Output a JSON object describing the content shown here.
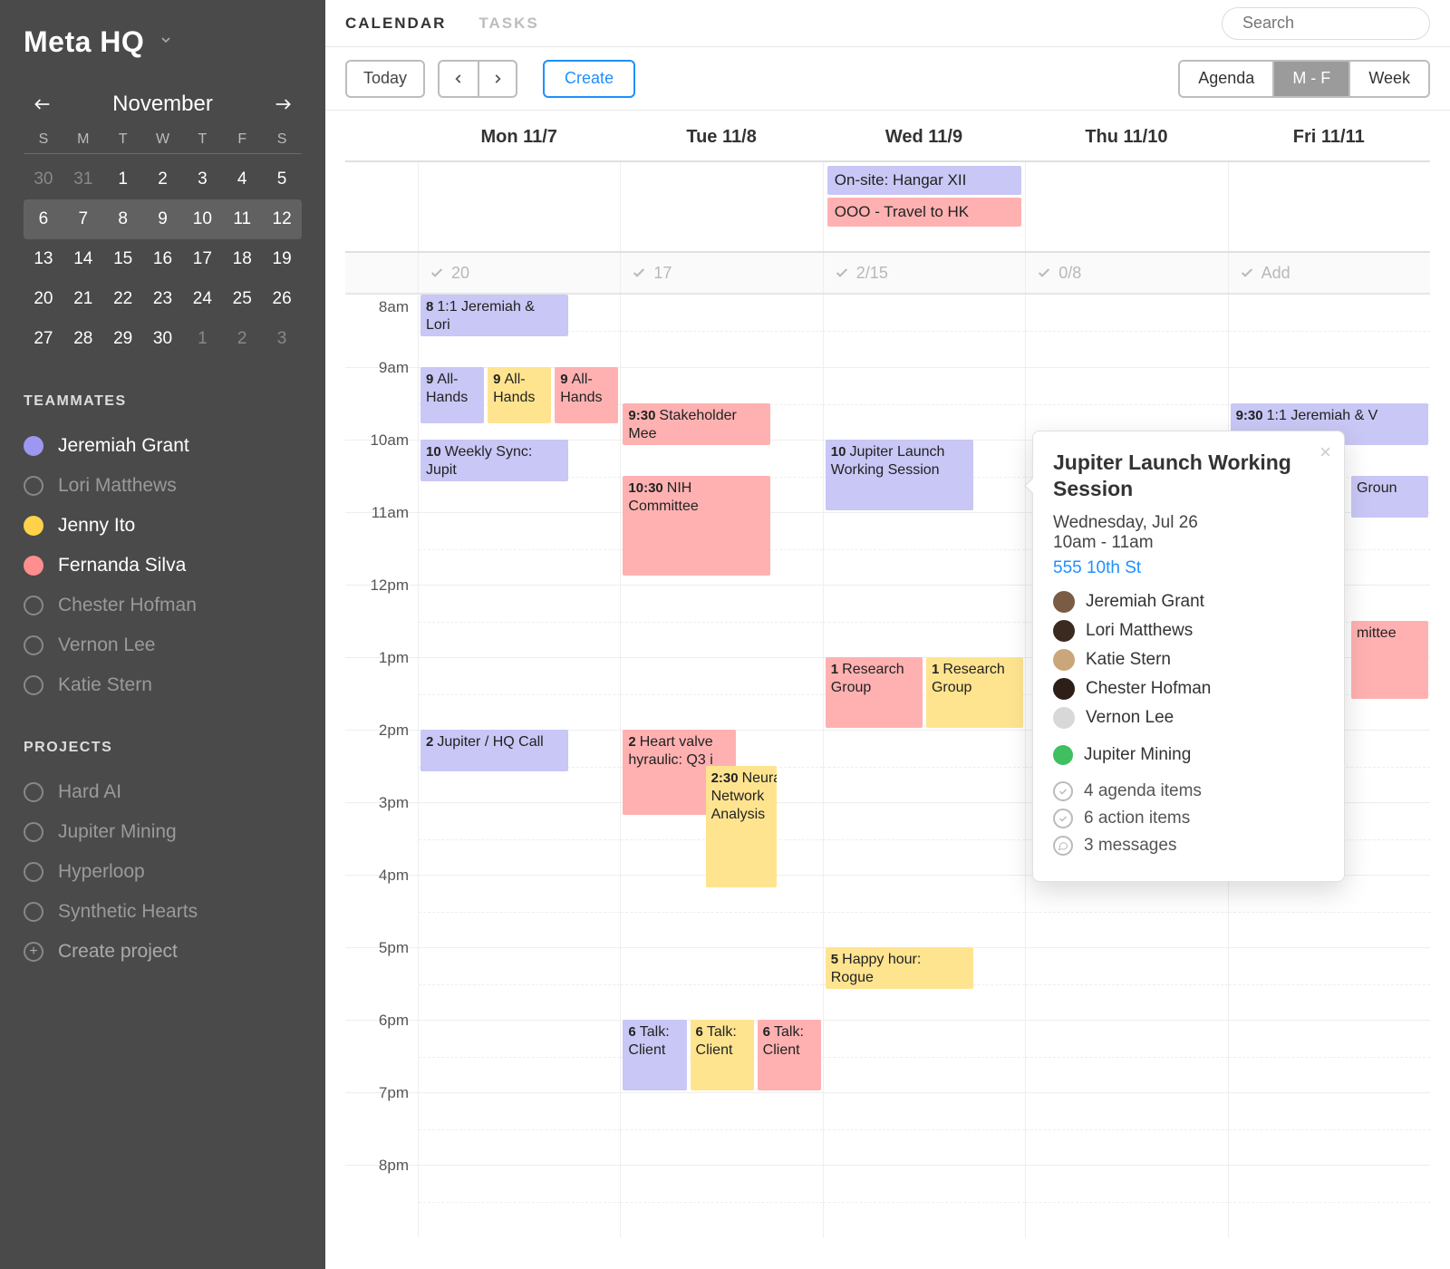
{
  "workspace": {
    "name": "Meta HQ"
  },
  "sidebar": {
    "month_label": "November",
    "dow": [
      "S",
      "M",
      "T",
      "W",
      "T",
      "F",
      "S"
    ],
    "weeks": [
      [
        {
          "n": "30",
          "off": true
        },
        {
          "n": "31",
          "off": true
        },
        {
          "n": "1"
        },
        {
          "n": "2"
        },
        {
          "n": "3"
        },
        {
          "n": "4"
        },
        {
          "n": "5"
        }
      ],
      [
        {
          "n": "6"
        },
        {
          "n": "7"
        },
        {
          "n": "8"
        },
        {
          "n": "9"
        },
        {
          "n": "10"
        },
        {
          "n": "11"
        },
        {
          "n": "12"
        }
      ],
      [
        {
          "n": "13"
        },
        {
          "n": "14"
        },
        {
          "n": "15"
        },
        {
          "n": "16"
        },
        {
          "n": "17"
        },
        {
          "n": "18"
        },
        {
          "n": "19"
        }
      ],
      [
        {
          "n": "20"
        },
        {
          "n": "21"
        },
        {
          "n": "22"
        },
        {
          "n": "23"
        },
        {
          "n": "24"
        },
        {
          "n": "25"
        },
        {
          "n": "26"
        }
      ],
      [
        {
          "n": "27"
        },
        {
          "n": "28"
        },
        {
          "n": "29"
        },
        {
          "n": "30"
        },
        {
          "n": "1",
          "off": true
        },
        {
          "n": "2",
          "off": true
        },
        {
          "n": "3",
          "off": true
        }
      ]
    ],
    "selected_week_index": 1,
    "teammates_label": "TEAMMATES",
    "teammates": [
      {
        "name": "Jeremiah Grant",
        "color": "#9d97f2",
        "active": true
      },
      {
        "name": "Lori Matthews",
        "color": null,
        "active": false
      },
      {
        "name": "Jenny Ito",
        "color": "#ffd24a",
        "active": true
      },
      {
        "name": "Fernanda Silva",
        "color": "#ff8e8e",
        "active": true
      },
      {
        "name": "Chester Hofman",
        "color": null,
        "active": false
      },
      {
        "name": "Vernon Lee",
        "color": null,
        "active": false
      },
      {
        "name": "Katie Stern",
        "color": null,
        "active": false
      }
    ],
    "projects_label": "PROJECTS",
    "projects": [
      {
        "name": "Hard AI"
      },
      {
        "name": "Jupiter Mining"
      },
      {
        "name": "Hyperloop"
      },
      {
        "name": "Synthetic Hearts"
      }
    ],
    "create_project_label": "Create project"
  },
  "topbar": {
    "tab_calendar": "CALENDAR",
    "tab_tasks": "TASKS",
    "search_placeholder": "Search"
  },
  "toolbar": {
    "today_label": "Today",
    "create_label": "Create",
    "views": [
      "Agenda",
      "M - F",
      "Week"
    ],
    "selected_view_index": 1
  },
  "calendar": {
    "days": [
      "Mon 11/7",
      "Tue 11/8",
      "Wed 11/9",
      "Thu 11/10",
      "Fri 11/11"
    ],
    "hours": [
      "8am",
      "9am",
      "10am",
      "11am",
      "12pm",
      "1pm",
      "2pm",
      "3pm",
      "4pm",
      "5pm",
      "6pm",
      "7pm",
      "8pm"
    ],
    "allday": {
      "2": [
        {
          "title": "On-site: Hangar XII",
          "color": "purple"
        },
        {
          "title": "OOO - Travel to HK",
          "color": "red"
        }
      ]
    },
    "taskcounts": [
      "20",
      "17",
      "2/15",
      "0/8",
      "Add"
    ],
    "events": [
      {
        "day": 0,
        "start": 8,
        "end": 8.6,
        "time": "8",
        "title": "1:1 Jeremiah & Lori",
        "color": "purple",
        "lane": 0,
        "lanes": 1,
        "width": 0.75
      },
      {
        "day": 0,
        "start": 9,
        "end": 9.8,
        "time": "9",
        "title": "All-Hands",
        "color": "purple",
        "lane": 0,
        "lanes": 3
      },
      {
        "day": 0,
        "start": 9,
        "end": 9.8,
        "time": "9",
        "title": "All-Hands",
        "color": "yellow",
        "lane": 1,
        "lanes": 3
      },
      {
        "day": 0,
        "start": 9,
        "end": 9.8,
        "time": "9",
        "title": "All-Hands",
        "color": "red",
        "lane": 2,
        "lanes": 3
      },
      {
        "day": 0,
        "start": 10,
        "end": 10.6,
        "time": "10",
        "title": "Weekly Sync: Jupit",
        "color": "purple",
        "lane": 0,
        "lanes": 1,
        "width": 0.75
      },
      {
        "day": 0,
        "start": 14,
        "end": 14.6,
        "time": "2",
        "title": "Jupiter / HQ Call",
        "color": "purple",
        "lane": 0,
        "lanes": 1,
        "width": 0.75
      },
      {
        "day": 1,
        "start": 9.5,
        "end": 10.1,
        "time": "9:30",
        "title": "Stakeholder Mee",
        "color": "red",
        "lane": 0,
        "lanes": 1,
        "width": 0.75
      },
      {
        "day": 1,
        "start": 10.5,
        "end": 11.9,
        "time": "10:30",
        "title": "NIH Committee",
        "color": "red",
        "lane": 0,
        "lanes": 1,
        "width": 0.75
      },
      {
        "day": 1,
        "start": 14,
        "end": 15.2,
        "time": "2",
        "title": "Heart valve hyraulic: Q3 i",
        "color": "red",
        "lane": 0,
        "lanes": 1,
        "width": 0.58
      },
      {
        "day": 1,
        "start": 14.5,
        "end": 16.2,
        "time": "2:30",
        "title": "Neural Network Analysis",
        "color": "yellow",
        "lane": 1,
        "lanes": 1,
        "left": 0.41,
        "width": 0.37
      },
      {
        "day": 1,
        "start": 18,
        "end": 19,
        "time": "6",
        "title": "Talk: Client",
        "color": "purple",
        "lane": 0,
        "lanes": 3
      },
      {
        "day": 1,
        "start": 18,
        "end": 19,
        "time": "6",
        "title": "Talk: Client",
        "color": "yellow",
        "lane": 1,
        "lanes": 3
      },
      {
        "day": 1,
        "start": 18,
        "end": 19,
        "time": "6",
        "title": "Talk: Client",
        "color": "red",
        "lane": 2,
        "lanes": 3
      },
      {
        "day": 2,
        "start": 10,
        "end": 11,
        "time": "10",
        "title": "Jupiter Launch Working Session",
        "color": "purple",
        "lane": 0,
        "lanes": 1,
        "width": 0.75
      },
      {
        "day": 2,
        "start": 13,
        "end": 14,
        "time": "1",
        "title": "Research Group",
        "color": "red",
        "lane": 0,
        "lanes": 2
      },
      {
        "day": 2,
        "start": 13,
        "end": 14,
        "time": "1",
        "title": "Research Group",
        "color": "yellow",
        "lane": 1,
        "lanes": 2
      },
      {
        "day": 2,
        "start": 17,
        "end": 17.6,
        "time": "5",
        "title": "Happy hour: Rogue",
        "color": "yellow",
        "lane": 0,
        "lanes": 1,
        "width": 0.75
      },
      {
        "day": 4,
        "start": 9.5,
        "end": 10.1,
        "time": "9:30",
        "title": "1:1 Jeremiah & V",
        "color": "purple",
        "lane": 0,
        "lanes": 1
      },
      {
        "day": 4,
        "start": 10.5,
        "end": 11.1,
        "time": "",
        "title": "Groun",
        "color": "purple",
        "lane": 0,
        "lanes": 1,
        "left": 0.6,
        "width": 0.4
      },
      {
        "day": 4,
        "start": 12.5,
        "end": 13.6,
        "time": "",
        "title": "mittee",
        "color": "red",
        "lane": 0,
        "lanes": 1,
        "left": 0.6,
        "width": 0.4
      }
    ]
  },
  "popover": {
    "title": "Jupiter Launch Working Session",
    "date": "Wednesday, Jul 26",
    "time": "10am - 11am",
    "location": "555 10th St",
    "attendees": [
      {
        "name": "Jeremiah Grant",
        "av": "#7a5c44"
      },
      {
        "name": "Lori Matthews",
        "av": "#3b2a1f"
      },
      {
        "name": "Katie Stern",
        "av": "#c9a77a"
      },
      {
        "name": "Chester Hofman",
        "av": "#2d1f17"
      },
      {
        "name": "Vernon Lee",
        "av": "#d8d8d8"
      }
    ],
    "project": "Jupiter Mining",
    "info": [
      "4 agenda items",
      "6 action items",
      "3 messages"
    ]
  }
}
